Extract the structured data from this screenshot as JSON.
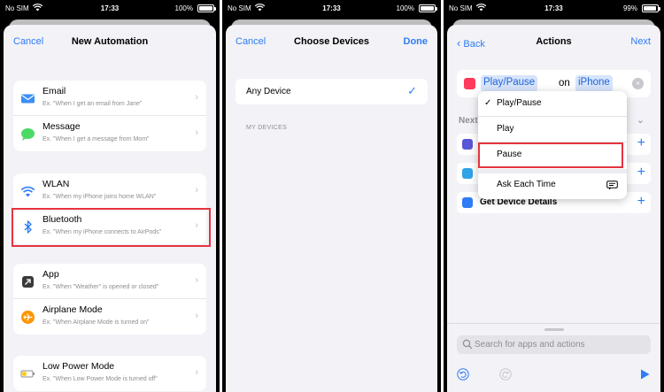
{
  "screens": [
    {
      "status": {
        "carrier": "No SIM",
        "time": "17:33",
        "battery": "100%",
        "battery_level": 1.0
      },
      "nav": {
        "left": "Cancel",
        "title": "New Automation"
      },
      "groups": [
        [
          {
            "title": "Email",
            "sub": "Ex. \"When I get an email from Jane\"",
            "icon": "mail-icon"
          },
          {
            "title": "Message",
            "sub": "Ex. \"When I get a message from Mom\"",
            "icon": "message-icon"
          }
        ],
        [
          {
            "title": "WLAN",
            "sub": "Ex. \"When my iPhone joins home WLAN\"",
            "icon": "wifi-icon"
          },
          {
            "title": "Bluetooth",
            "sub": "Ex. \"When my iPhone connects to AirPods\"",
            "icon": "bluetooth-icon"
          }
        ],
        [
          {
            "title": "App",
            "sub": "Ex. \"When \"Weather\" is opened or closed\"",
            "icon": "app-arrow-icon"
          },
          {
            "title": "Airplane Mode",
            "sub": "Ex. \"When Airplane Mode is turned on\"",
            "icon": "airplane-icon"
          }
        ],
        [
          {
            "title": "Low Power Mode",
            "sub": "Ex. \"When Low Power Mode is turned off\"",
            "icon": "battery-icon"
          }
        ]
      ]
    },
    {
      "status": {
        "carrier": "No SIM",
        "time": "17:33",
        "battery": "100%",
        "battery_level": 1.0
      },
      "nav": {
        "left": "Cancel",
        "title": "Choose Devices",
        "right": "Done"
      },
      "option": "Any Device",
      "section": "MY DEVICES"
    },
    {
      "status": {
        "carrier": "No SIM",
        "time": "17:33",
        "battery": "99%",
        "battery_level": 0.99
      },
      "nav": {
        "left": "Back",
        "title": "Actions",
        "right": "Next"
      },
      "action": {
        "token1": "Play/Pause",
        "word": "on",
        "token2": "iPhone"
      },
      "next_header": "Next",
      "suggestions": [
        {
          "label": "",
          "color": "#5856d6"
        },
        {
          "label": "",
          "color": "#30a2e6"
        },
        {
          "label": "Get Device Details",
          "color": "#2f7cf6"
        }
      ],
      "menu": {
        "items": [
          "Play/Pause",
          "Play",
          "Pause",
          "Ask Each Time"
        ],
        "selected": "Play/Pause"
      },
      "search_placeholder": "Search for apps and actions"
    }
  ]
}
